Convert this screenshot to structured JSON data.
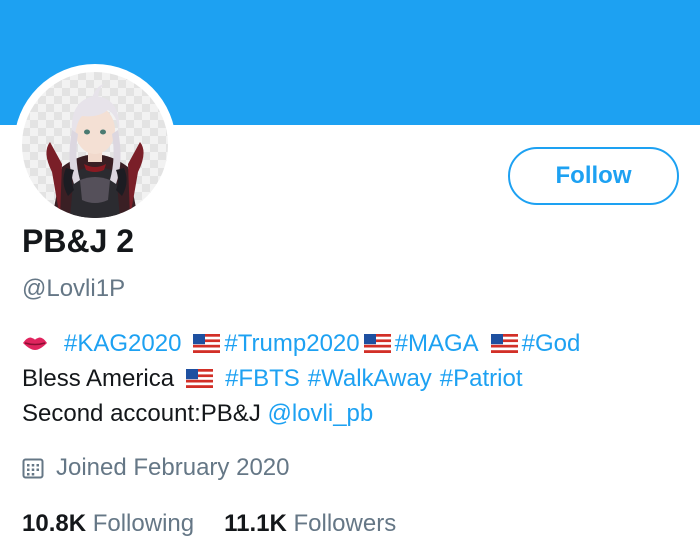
{
  "profile": {
    "display_name": "PB&J 2",
    "handle": "@Lovli1P",
    "follow_label": "Follow",
    "bio": {
      "line1": {
        "tag1": "#KAG2020",
        "tag2": "#Trump2020",
        "tag3": "#MAGA",
        "tag4": "#God"
      },
      "line2": {
        "text": "Bless America",
        "tag1": "#FBTS",
        "tag2": "#WalkAway",
        "tag3": "#Patriot"
      },
      "line3": {
        "text": "Second account:PB&J",
        "mention": "@lovli_pb"
      }
    },
    "joined": "Joined February 2020",
    "following_count": "10.8K",
    "following_label": "Following",
    "followers_count": "11.1K",
    "followers_label": "Followers"
  },
  "icons": {
    "avatar": "profile-avatar-image",
    "lips": "lips-emoji",
    "flag": "us-flag-emoji",
    "calendar": "calendar-icon"
  },
  "colors": {
    "banner": "#1da1f2",
    "accent": "#1da1f2",
    "text": "#14171a",
    "muted": "#657786"
  }
}
